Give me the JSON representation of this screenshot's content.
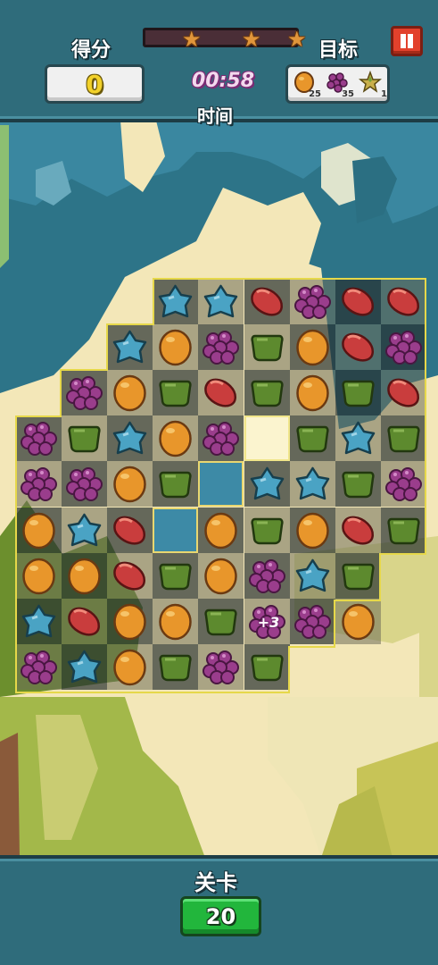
{
  "hud": {
    "score_label": "得分",
    "score_value": "0",
    "timer": "00:58",
    "time_label": "时间",
    "target_label": "目标",
    "star_progress": 0,
    "stars": [
      {
        "name": "star-1"
      },
      {
        "name": "star-2"
      },
      {
        "name": "star-3"
      }
    ],
    "goals": [
      {
        "icon": "orange-bean-icon",
        "count": "25"
      },
      {
        "icon": "grape-icon",
        "count": "35"
      },
      {
        "icon": "star-icon",
        "count": "1"
      }
    ]
  },
  "popup_text": "+3",
  "bottom": {
    "level_label": "关卡",
    "level_value": "20"
  },
  "colors": {
    "hud": "#2f6c7b",
    "orange": "#e8962b",
    "grape": "#9a3d8c",
    "bean": "#c93d3d",
    "leaf": "#5d8a2e",
    "drop": "#4aa3c4",
    "level_button": "#22b63c"
  },
  "legend_pieces": {
    "O": "orange-candy",
    "P": "grape-candy",
    "R": "red-bean-candy",
    "G": "green-leaf-candy",
    "B": "blue-star-candy",
    "E": "empty-cell",
    "H": "hole-cell",
    "-": "no-cell"
  },
  "board": [
    "---BBRPRR",
    "--BOPGORP",
    "-POGRGOGR",
    "PGBOPEGBG",
    "PPOGHBBGP",
    "OBRHOGORG",
    "OORGOPBG-",
    "BROOGPPO-",
    "PBOGPG---"
  ]
}
